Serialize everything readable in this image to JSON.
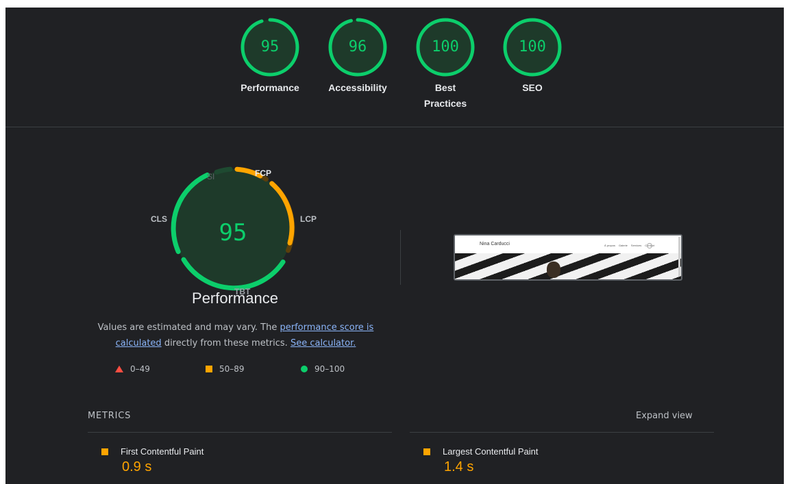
{
  "summary_gauges": [
    {
      "score": "95",
      "label": "Performance",
      "fraction": 0.95
    },
    {
      "score": "96",
      "label": "Accessibility",
      "fraction": 0.96
    },
    {
      "score": "100",
      "label": "Best Practices",
      "fraction": 1.0
    },
    {
      "score": "100",
      "label": "SEO",
      "fraction": 1.0
    }
  ],
  "performance": {
    "score": "95",
    "title": "Performance",
    "gauge_labels": {
      "si": "SI",
      "fcp": "FCP",
      "lcp": "LCP",
      "tbt": "TBT",
      "cls": "CLS"
    },
    "description": {
      "part1": "Values are estimated and may vary. The ",
      "link1": "performance score is calculated",
      "part2": " directly from these metrics. ",
      "link2": "See calculator."
    },
    "legend": {
      "fail": "0–49",
      "average": "50–89",
      "pass": "90–100"
    }
  },
  "screenshot": {
    "site_name": "Nina Carducci",
    "nav_links": [
      "À propos",
      "Galerie",
      "Services",
      "Contact"
    ]
  },
  "metrics": {
    "header": "METRICS",
    "expand_label": "Expand view",
    "items": [
      {
        "title": "First Contentful Paint",
        "value": "0.9 s"
      },
      {
        "title": "Largest Contentful Paint",
        "value": "1.4 s"
      }
    ]
  },
  "colors": {
    "pass": "#0cce6b",
    "average": "#ffa400",
    "fail": "#ff4e42",
    "background": "#202124"
  }
}
